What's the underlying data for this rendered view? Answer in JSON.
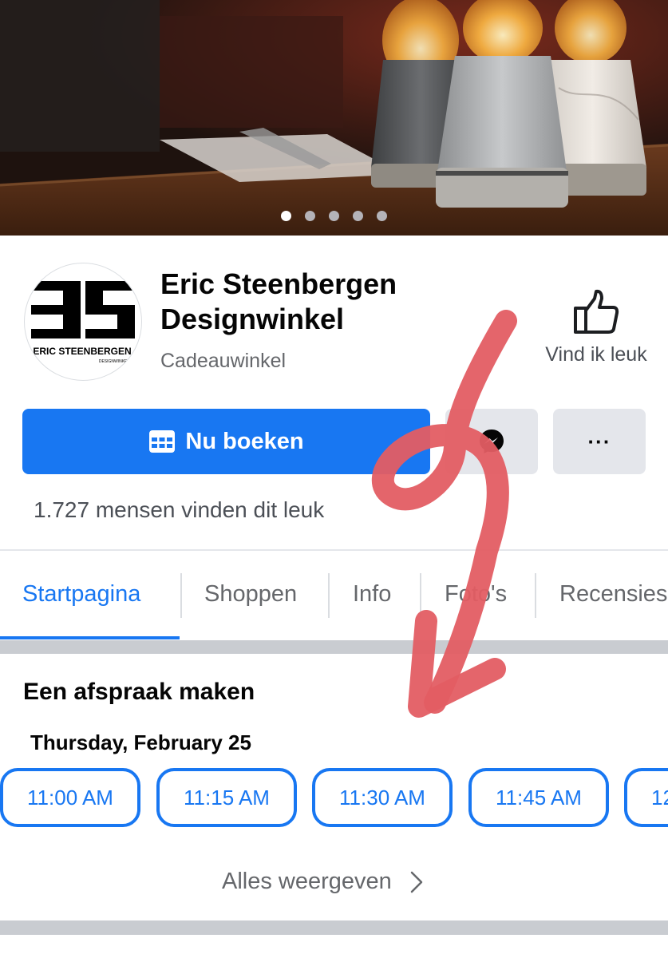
{
  "page": {
    "name": "Eric Steenbergen Designwinkel",
    "category": "Cadeauwinkel",
    "logo_text": "ERIC STEENBERGEN",
    "logo_subtext": "DESIGNWINKEL"
  },
  "cover": {
    "slide_count": 5,
    "active_slide": 1
  },
  "actions": {
    "like_label": "Vind ik leuk",
    "book_label": "Nu boeken",
    "more_label": "···"
  },
  "likes_text": "1.727 mensen vinden dit leuk",
  "tabs": [
    {
      "label": "Startpagina",
      "active": true
    },
    {
      "label": "Shoppen"
    },
    {
      "label": "Info"
    },
    {
      "label": "Foto's"
    },
    {
      "label": "Recensies"
    }
  ],
  "appointment": {
    "title": "Een afspraak maken",
    "date": "Thursday, February 25",
    "slots": [
      "11:00 AM",
      "11:15 AM",
      "11:30 AM",
      "11:45 AM",
      "12"
    ],
    "show_all": "Alles weergeven"
  },
  "colors": {
    "accent": "#1877f2",
    "secondary_button": "#e4e6eb",
    "muted_text": "#65676b",
    "annotation": "#e35d63"
  },
  "icons": {
    "like": "thumbs-up-icon",
    "book": "calendar-icon",
    "messenger": "messenger-icon",
    "more": "more-options-icon",
    "show_all": "chevron-right-icon"
  }
}
